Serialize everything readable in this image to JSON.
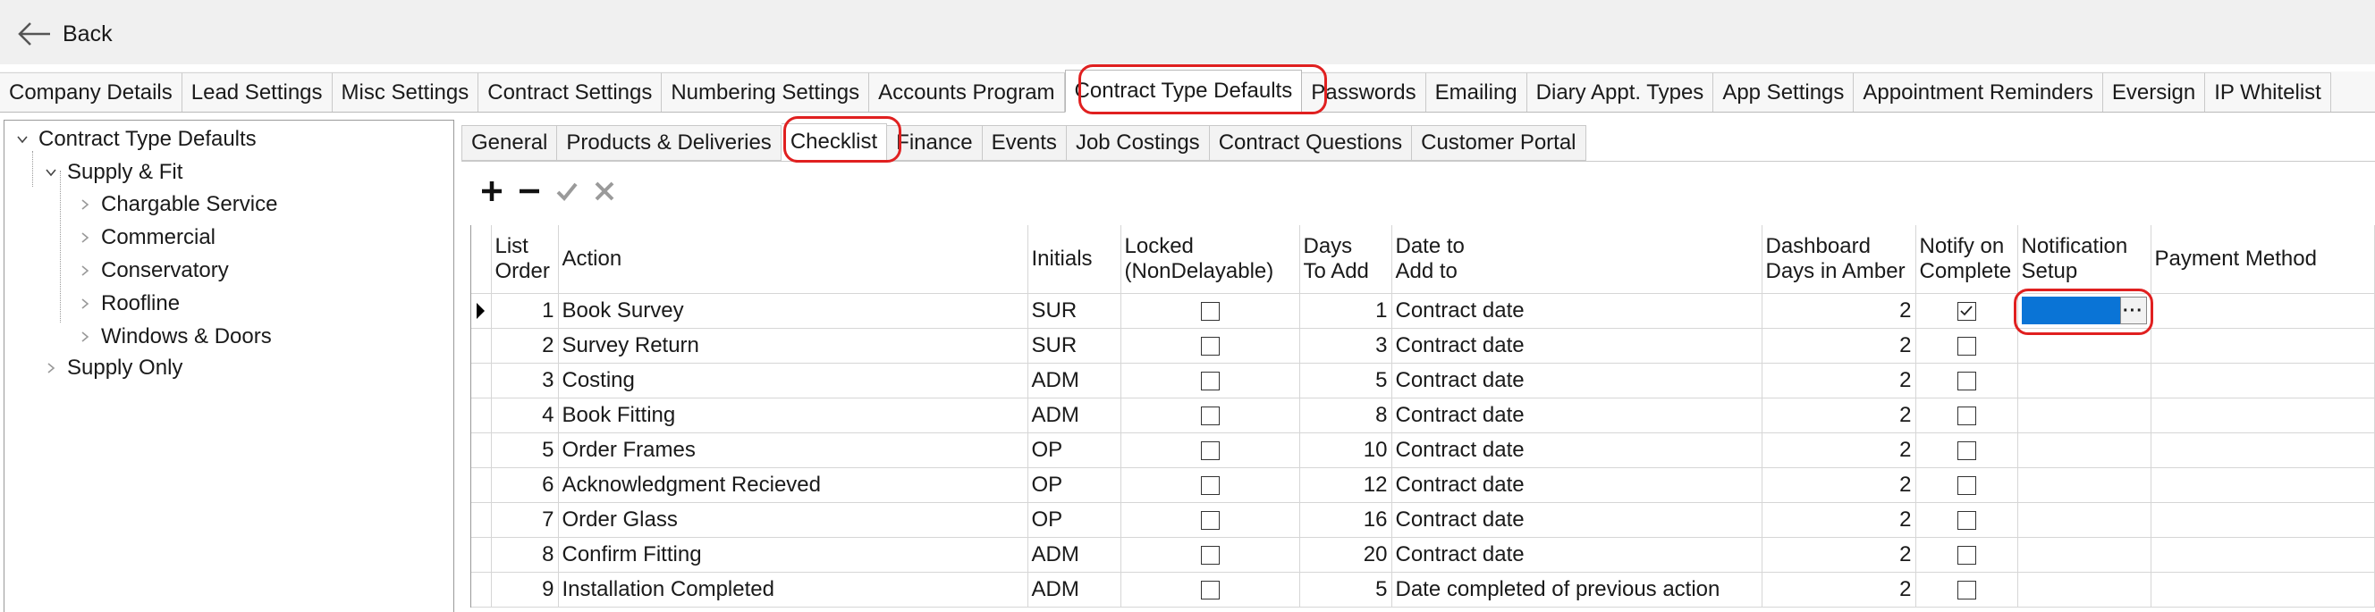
{
  "back_label": "Back",
  "main_tabs": [
    "Company Details",
    "Lead Settings",
    "Misc Settings",
    "Contract Settings",
    "Numbering Settings",
    "Accounts Program",
    "Contract Type Defaults",
    "Passwords",
    "Emailing",
    "Diary Appt. Types",
    "App Settings",
    "Appointment Reminders",
    "Eversign",
    "IP Whitelist"
  ],
  "main_active_tab": "Contract Type Defaults",
  "tree": {
    "root": "Contract Type Defaults",
    "supply_fit": "Supply & Fit",
    "children": [
      "Chargable Service",
      "Commercial",
      "Conservatory",
      "Roofline",
      "Windows & Doors"
    ],
    "supply_only": "Supply Only"
  },
  "sub_tabs": [
    "General",
    "Products & Deliveries",
    "Checklist",
    "Finance",
    "Events",
    "Job Costings",
    "Contract Questions",
    "Customer Portal"
  ],
  "sub_active_tab": "Checklist",
  "toolbar_icons": [
    "plus-icon",
    "minus-icon",
    "check-icon",
    "cross-icon"
  ],
  "grid": {
    "headers": {
      "list_order_1": "List",
      "list_order_2": "Order",
      "action": "Action",
      "initials": "Initials",
      "locked_1": "Locked",
      "locked_2": "(NonDelayable)",
      "days_1": "Days",
      "days_2": "To Add",
      "date_1": "Date to",
      "date_2": "Add to",
      "dash_1": "Dashboard",
      "dash_2": "Days in Amber",
      "notify_1": "Notify on",
      "notify_2": "Complete",
      "notif_1": "Notification",
      "notif_2": "Setup",
      "payment": "Payment Method"
    },
    "rows": [
      {
        "order": "1",
        "action": "Book Survey",
        "initials": "SUR",
        "locked": false,
        "days": "1",
        "date": "Contract date",
        "amber": "2",
        "notify": true
      },
      {
        "order": "2",
        "action": "Survey Return",
        "initials": "SUR",
        "locked": false,
        "days": "3",
        "date": "Contract date",
        "amber": "2",
        "notify": false
      },
      {
        "order": "3",
        "action": "Costing",
        "initials": "ADM",
        "locked": false,
        "days": "5",
        "date": "Contract date",
        "amber": "2",
        "notify": false
      },
      {
        "order": "4",
        "action": "Book Fitting",
        "initials": "ADM",
        "locked": false,
        "days": "8",
        "date": "Contract date",
        "amber": "2",
        "notify": false
      },
      {
        "order": "5",
        "action": "Order Frames",
        "initials": "OP",
        "locked": false,
        "days": "10",
        "date": "Contract date",
        "amber": "2",
        "notify": false
      },
      {
        "order": "6",
        "action": "Acknowledgment Recieved",
        "initials": "OP",
        "locked": false,
        "days": "12",
        "date": "Contract date",
        "amber": "2",
        "notify": false
      },
      {
        "order": "7",
        "action": "Order Glass",
        "initials": "OP",
        "locked": false,
        "days": "16",
        "date": "Contract date",
        "amber": "2",
        "notify": false
      },
      {
        "order": "8",
        "action": "Confirm Fitting",
        "initials": "ADM",
        "locked": false,
        "days": "20",
        "date": "Contract date",
        "amber": "2",
        "notify": false
      },
      {
        "order": "9",
        "action": "Installation Completed",
        "initials": "ADM",
        "locked": false,
        "days": "5",
        "date": "Date completed of previous action",
        "amber": "2",
        "notify": false
      }
    ],
    "edit_button_label": "···"
  },
  "colors": {
    "highlight": "#e02020",
    "selection": "#0a74d6"
  }
}
